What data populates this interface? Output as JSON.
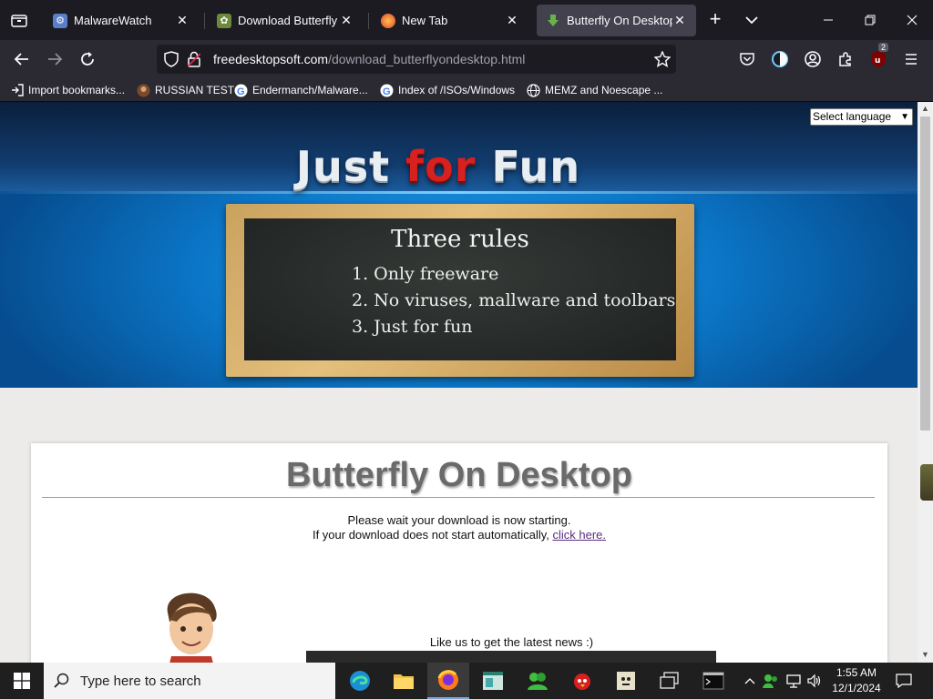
{
  "browser": {
    "tabs": [
      {
        "title": "MalwareWatch",
        "active": false
      },
      {
        "title": "Download Butterfly On Desktop",
        "active": false
      },
      {
        "title": "New Tab",
        "active": false
      },
      {
        "title": "Butterfly On Desktop download",
        "active": true
      }
    ],
    "url_domain": "freedesktopsoft.com",
    "url_path": "/download_butterflyondesktop.html",
    "extension_badge": "2",
    "bookmarks": [
      {
        "label": "Import bookmarks..."
      },
      {
        "label": "RUSSIAN TEST"
      },
      {
        "label": "Endermanch/Malware..."
      },
      {
        "label": "Index of /ISOs/Windows"
      },
      {
        "label": "MEMZ and Noescape ..."
      }
    ]
  },
  "page": {
    "language_select": "Select language",
    "site_title_part1": "Just ",
    "site_title_part2": "for",
    "site_title_part3": " Fun",
    "board_title": "Three rules",
    "rules": [
      "1. Only freeware",
      "2. No viruses, mallware and toolbars",
      "3. Just for fun"
    ],
    "product_title": "Butterfly On Desktop",
    "wait_message": "Please wait your download is now starting.",
    "fallback_prefix": "If your download does not start automatically, ",
    "fallback_link": "click here.",
    "like_text": "Like us to get the latest news :)"
  },
  "taskbar": {
    "search_placeholder": "Type here to search",
    "time": "1:55 AM",
    "date": "12/1/2024"
  },
  "colors": {
    "accent_red": "#d8201f",
    "link_purple": "#5b2c82"
  }
}
